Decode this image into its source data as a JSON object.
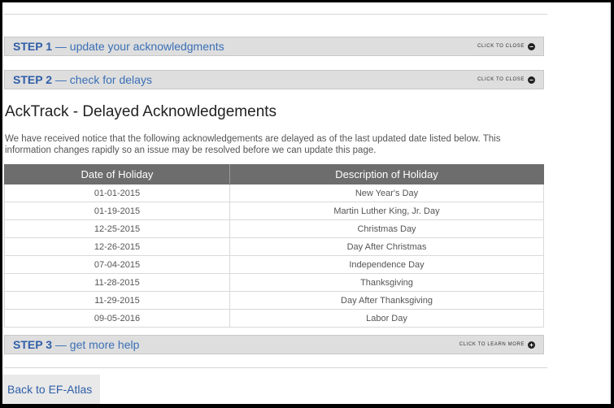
{
  "steps": [
    {
      "number": "STEP 1",
      "dash": "—",
      "title": "update your acknowledgments",
      "action": "CLICK TO CLOSE",
      "icon": "minus-icon"
    },
    {
      "number": "STEP 2",
      "dash": "—",
      "title": "check for delays",
      "action": "CLICK TO CLOSE",
      "icon": "minus-icon"
    },
    {
      "number": "STEP 3",
      "dash": "—",
      "title": "get more help",
      "action": "CLICK TO LEARN MORE",
      "icon": "plus-icon"
    }
  ],
  "page": {
    "title": "AckTrack - Delayed Acknowledgements",
    "notice": "We have received notice that the following acknowledgements are delayed as of the last updated date listed below. This information changes rapidly so an issue may be resolved before we can update this page."
  },
  "table": {
    "headers": [
      "Date of Holiday",
      "Description of Holiday"
    ],
    "rows": [
      [
        "01-01-2015",
        "New Year's Day"
      ],
      [
        "01-19-2015",
        "Martin Luther King, Jr. Day"
      ],
      [
        "12-25-2015",
        "Christmas Day"
      ],
      [
        "12-26-2015",
        "Day After Christmas"
      ],
      [
        "07-04-2015",
        "Independence Day"
      ],
      [
        "11-28-2015",
        "Thanksgiving"
      ],
      [
        "11-29-2015",
        "Day After Thanksgiving"
      ],
      [
        "09-05-2016",
        "Labor Day"
      ]
    ]
  },
  "footer": {
    "back_label": "Back to EF-Atlas"
  },
  "colors": {
    "step_bar": "#dedede",
    "step_text": "#3a6fb5",
    "table_header": "#6d6d6d",
    "frame_border": "#000000"
  }
}
